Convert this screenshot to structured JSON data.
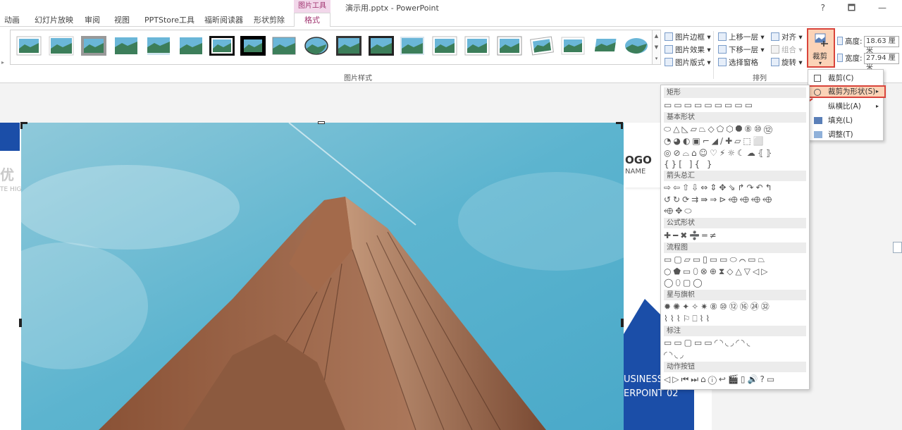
{
  "window": {
    "title": "演示用.pptx - PowerPoint",
    "controls": "? 🗖 —"
  },
  "tabs": [
    "动画",
    "幻灯片放映",
    "审阅",
    "视图",
    "PPTStore工具",
    "福昕阅读器",
    "形状剪除"
  ],
  "context_tab": {
    "group": "图片工具",
    "active": "格式"
  },
  "ribbon": {
    "picture_styles_label": "图片样式",
    "picture_border": "图片边框",
    "picture_effects": "图片效果",
    "picture_layout": "图片版式",
    "arrange_label": "排列",
    "bring_forward": "上移一层",
    "send_backward": "下移一层",
    "selection_pane": "选择窗格",
    "align": "对齐",
    "group": "组合",
    "rotate": "旋转",
    "crop": "裁剪",
    "height_label": "高度:",
    "height_value": "18.63 厘米",
    "width_label": "宽度:",
    "width_value": "27.94 厘米"
  },
  "slide": {
    "left_text_1": "优",
    "left_text_2": "TE HIG",
    "logo_text": "OGO",
    "logo_sub": "NAME",
    "biz_line1": "USINESS",
    "biz_line2": "ERPOINT 02"
  },
  "crop_menu": {
    "items": [
      "裁剪(C)",
      "裁剪为形状(S)",
      "纵横比(A)",
      "填充(L)",
      "调整(T)"
    ]
  },
  "shape_menu": {
    "sections": [
      "矩形",
      "基本形状",
      "箭头总汇",
      "公式形状",
      "流程图",
      "星与旗帜",
      "标注",
      "动作按钮"
    ],
    "rows": {
      "rect": "▭▭▭▭▭▭▭▭▭",
      "basic1": "⬭△◺▱⏢◇⬠⬡⯃⑧⑩⑫",
      "basic2": "◔◕◐▣⌐◢∕✚▱⬚⬜",
      "basic3": "◎⊘⌓⌂☺♡⚡☼☾☁⦃⦄",
      "basic4": "{}[ ]{ }",
      "arrows1": "⇨⇦⇧⇩⇔⇕✥⇘↱↷↶↰",
      "arrows2": "↺↻⟳⇉⇛⇒⊳⬲⬲⬲⬲",
      "arrows3": "⬲✥⬭",
      "math": "✚━✖➗═≠",
      "flow1": "▭▢▱▭▯▭▭⬭⌒▭⏢",
      "flow2": "○⬟▭⬯⊗⊕⧗◇△▽◁▷",
      "flow3": "◯⬯▢◯",
      "stars1": "✹✺✦✧✷⑧⑩⑫⑯㉔㉜",
      "stars2": "⌇⌇⌇⚐⎕⌇⌇",
      "callout1": "▭▭▢▭▭◜◝◟◞◜◝◟",
      "callout2": "◜◝◟◞",
      "action": "◁▷⏮⏭⌂ⓘ↩🎬▯🔊?▭"
    }
  },
  "colors": {
    "context_accent": "#a0336f",
    "highlight": "#fbd3b7",
    "red_outline": "#d9443b",
    "slide_blue": "#1b4ea8"
  }
}
